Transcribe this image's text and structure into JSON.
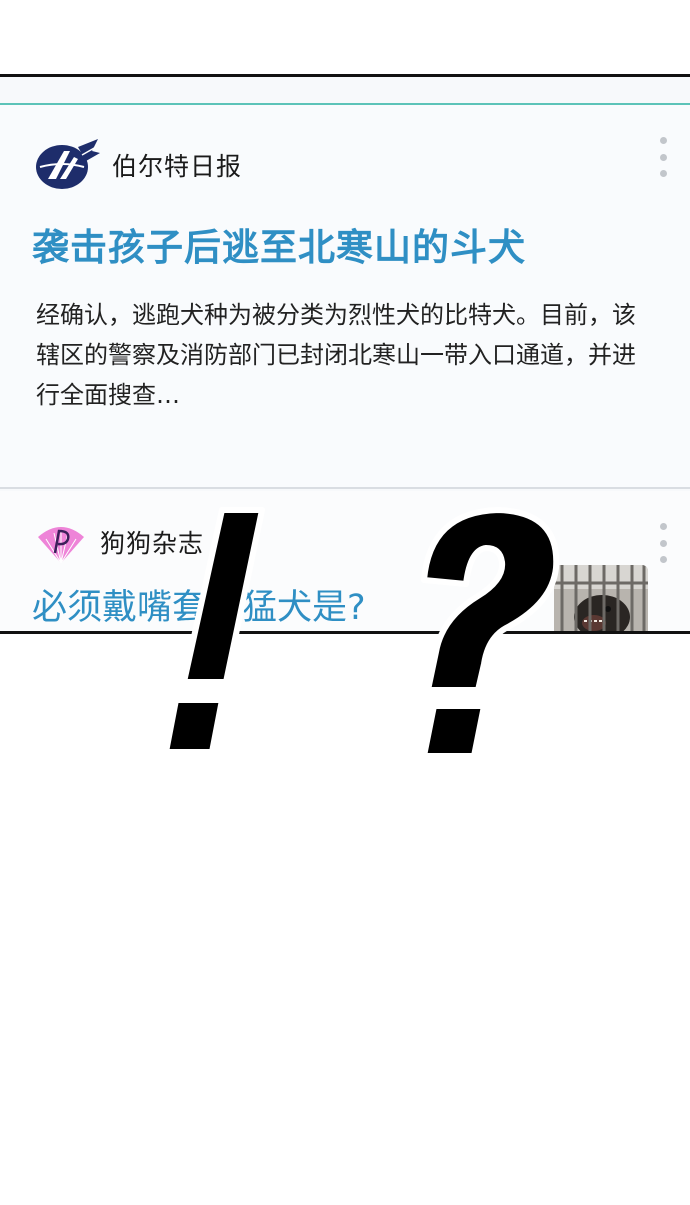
{
  "feed": {
    "items": [
      {
        "source": "伯尔特日报",
        "headline": "袭击孩子后逃至北寒山的斗犬",
        "summary": "经确认，逃跑犬种为被分类为烈性犬的比特犬。目前，该辖区的警察及消防部门已封闭北寒山一带入口通道，并进行全面搜查…",
        "logo_icon": "belt-daily-logo-icon"
      },
      {
        "source": "狗狗杂志",
        "headline": "必须戴嘴套的猛犬是?",
        "logo_icon": "dog-magazine-logo-icon"
      }
    ]
  },
  "overlay": {
    "marks": "!?"
  },
  "colors": {
    "headline": "#2f8fc4",
    "accent_line": "#5cc3b8",
    "logo_pink": "#ee84d8",
    "logo_navy": "#1e2d6b"
  }
}
